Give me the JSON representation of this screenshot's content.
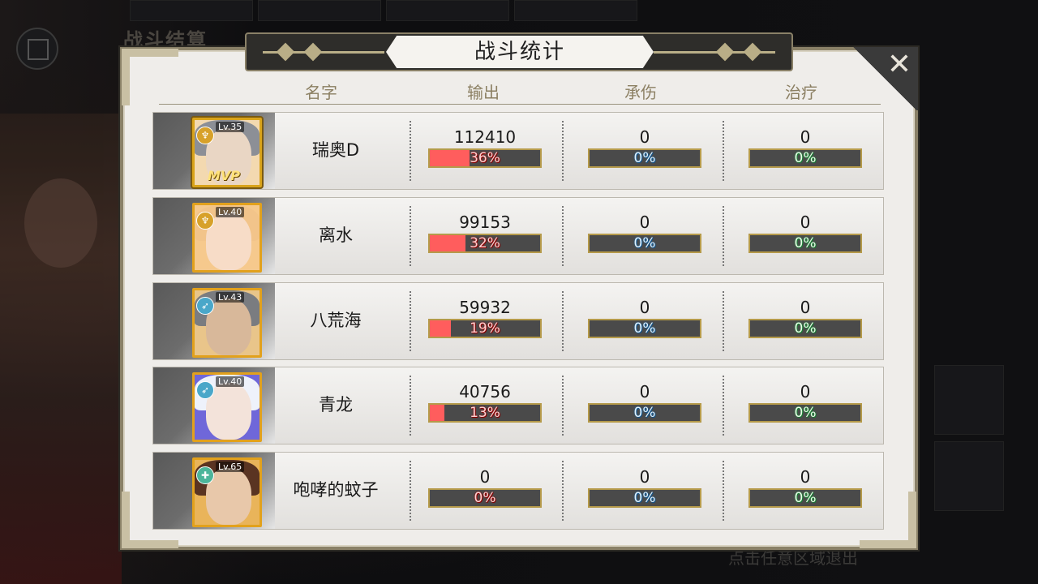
{
  "background": {
    "title": "战斗结算",
    "exit_hint": "点击任意区域退出"
  },
  "panel": {
    "title": "战斗统计",
    "close_icon": "close-icon",
    "headers": {
      "name": "名字",
      "output": "输出",
      "tank": "承伤",
      "heal": "治疗"
    }
  },
  "rows": [
    {
      "name": "瑞奥D",
      "level": "Lv.35",
      "class_icon": "sword-class-icon",
      "mvp": "MVP",
      "output": "112410",
      "output_pct": "36%",
      "output_frac": 0.36,
      "tank": "0",
      "tank_pct": "0%",
      "heal": "0",
      "heal_pct": "0%"
    },
    {
      "name": "离水",
      "level": "Lv.40",
      "class_icon": "sword-class-icon",
      "mvp": "",
      "output": "99153",
      "output_pct": "32%",
      "output_frac": 0.32,
      "tank": "0",
      "tank_pct": "0%",
      "heal": "0",
      "heal_pct": "0%"
    },
    {
      "name": "八荒海",
      "level": "Lv.43",
      "class_icon": "bow-class-icon",
      "mvp": "",
      "output": "59932",
      "output_pct": "19%",
      "output_frac": 0.19,
      "tank": "0",
      "tank_pct": "0%",
      "heal": "0",
      "heal_pct": "0%"
    },
    {
      "name": "青龙",
      "level": "Lv.40",
      "class_icon": "bow-class-icon",
      "mvp": "",
      "output": "40756",
      "output_pct": "13%",
      "output_frac": 0.13,
      "tank": "0",
      "tank_pct": "0%",
      "heal": "0",
      "heal_pct": "0%"
    },
    {
      "name": "咆哮的蚊子",
      "level": "Lv.65",
      "class_icon": "heal-class-icon",
      "mvp": "",
      "output": "0",
      "output_pct": "0%",
      "output_frac": 0,
      "tank": "0",
      "tank_pct": "0%",
      "heal": "0",
      "heal_pct": "0%"
    }
  ],
  "colors": {
    "output_bar": "#ff5d5d",
    "bar_border": "#b59a4a",
    "avatar_border": "#e2a11c",
    "header_text": "#8b7f62"
  }
}
